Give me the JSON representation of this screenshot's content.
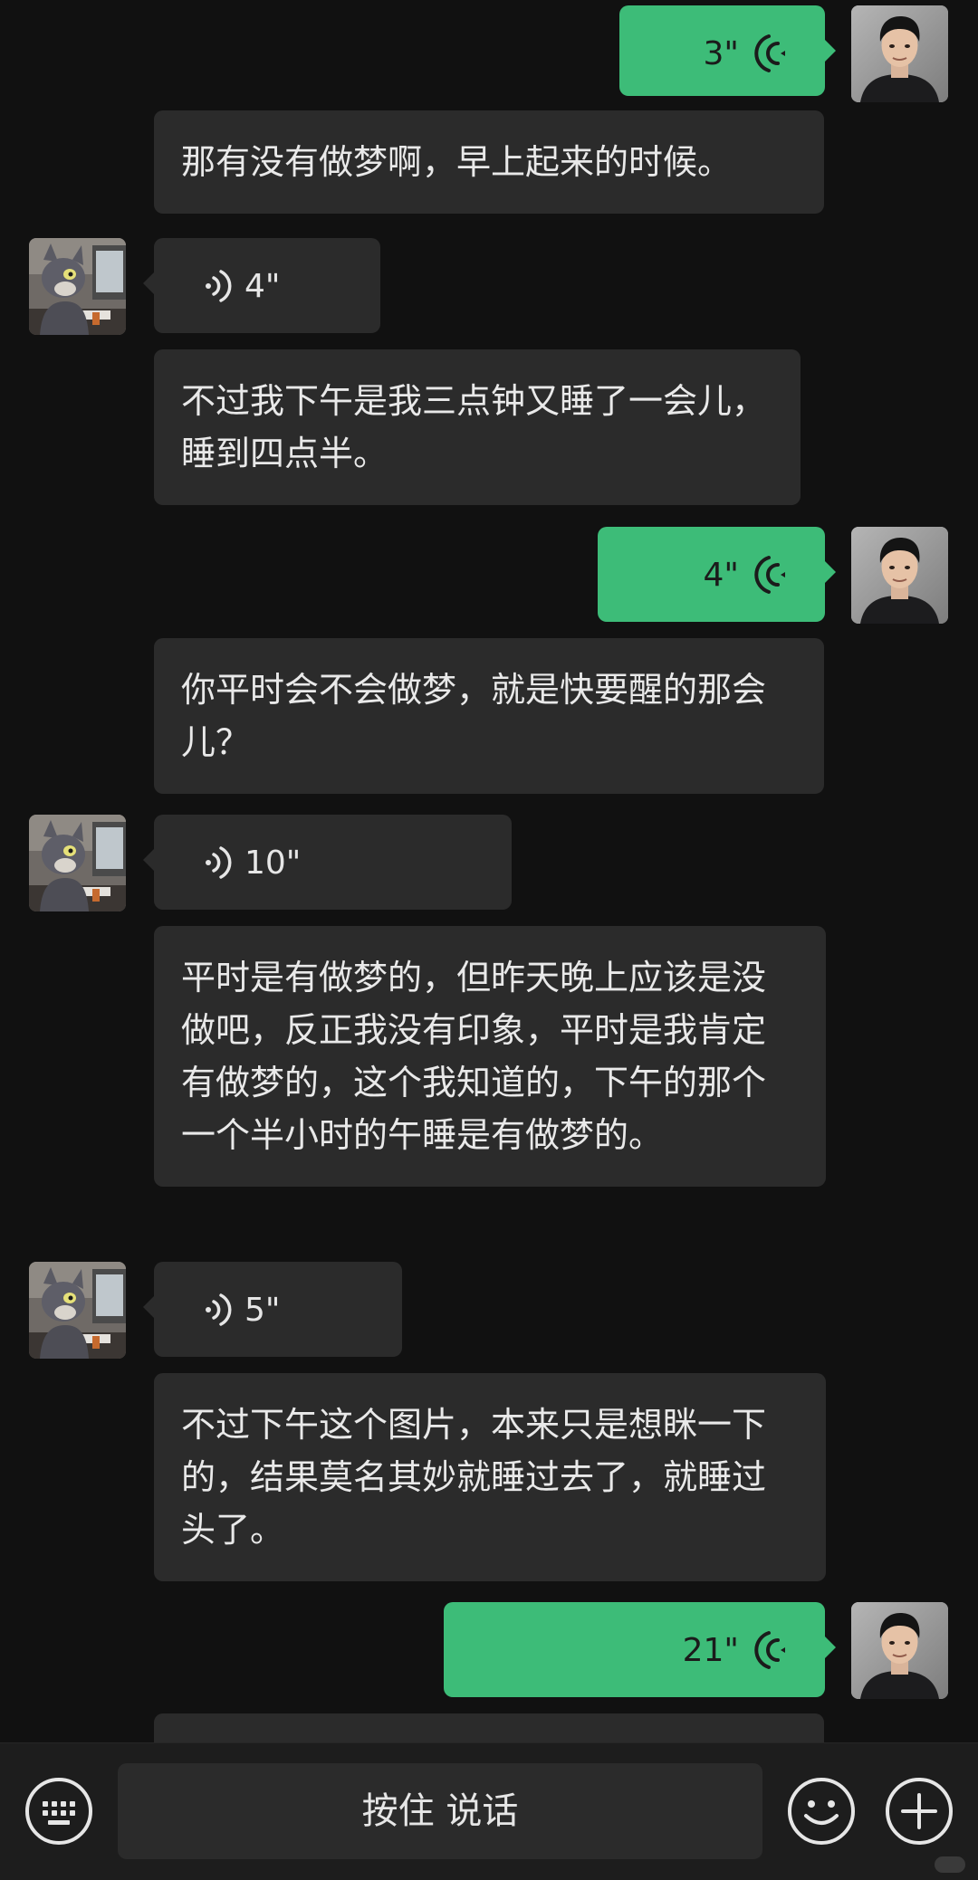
{
  "messages": [
    {
      "id": "m1",
      "side": "right",
      "type": "voice",
      "duration": "3\""
    },
    {
      "id": "m1t",
      "type": "transcript",
      "text": "那有没有做梦啊，早上起来的时候。"
    },
    {
      "id": "m2",
      "side": "left",
      "type": "voice",
      "duration": "4\""
    },
    {
      "id": "m2t",
      "type": "transcript",
      "text": "不过我下午是我三点钟又睡了一会儿，睡到四点半。"
    },
    {
      "id": "m3",
      "side": "right",
      "type": "voice",
      "duration": "4\""
    },
    {
      "id": "m3t",
      "type": "transcript",
      "text": "你平时会不会做梦，就是快要醒的那会儿？"
    },
    {
      "id": "m4",
      "side": "left",
      "type": "voice",
      "duration": "10\""
    },
    {
      "id": "m4t",
      "type": "transcript",
      "text": "平时是有做梦的，但昨天晚上应该是没做吧，反正我没有印象，平时是我肯定有做梦的，这个我知道的，下午的那个一个半小时的午睡是有做梦的。"
    },
    {
      "id": "m5",
      "side": "left",
      "type": "voice",
      "duration": "5\""
    },
    {
      "id": "m5t",
      "type": "transcript",
      "text": "不过下午这个图片，本来只是想眯一下的，结果莫名其妙就睡过去了，就睡过头了。"
    },
    {
      "id": "m6",
      "side": "right",
      "type": "voice",
      "duration": "21\""
    }
  ],
  "toolbar": {
    "keyboard_icon": "keyboard-icon",
    "hold_to_talk_label": "按住 说话",
    "emoji_icon": "emoji-icon",
    "plus_icon": "plus-icon"
  },
  "colors": {
    "background": "#111111",
    "sent_bubble": "#3dbc78",
    "received_bubble": "#2b2b2b",
    "toolbar": "#1d1d1d"
  }
}
